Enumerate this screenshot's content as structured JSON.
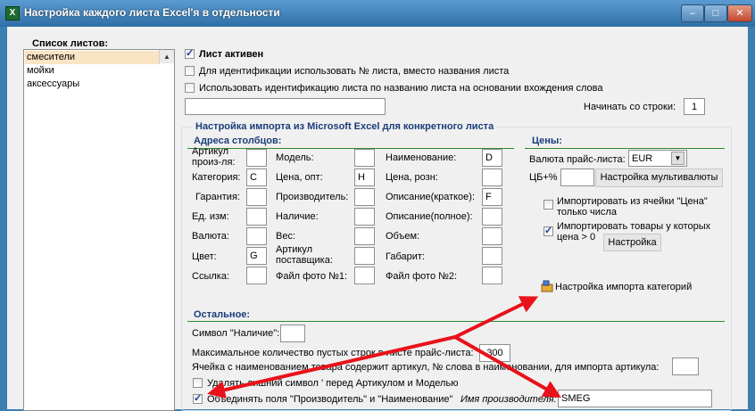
{
  "window": {
    "title": "Настройка каждого листа Excel'я в отдельности",
    "app_icon_text": "X",
    "minimize_glyph": "–",
    "maximize_glyph": "□",
    "close_glyph": "✕"
  },
  "sheets": {
    "header": "Список листов:",
    "items": [
      "смесители",
      "мойки",
      "аксессуары"
    ],
    "selected_index": 0
  },
  "general": {
    "sheet_active_label": "Лист активен",
    "sheet_active_checked": true,
    "use_number_label": "Для идентификации использовать № листа, вместо названия листа",
    "use_number_checked": false,
    "use_word_label": "Использовать идентификацию листа по названию листа на основании вхождения слова",
    "use_word_checked": false,
    "word_value": "",
    "start_row_label": "Начинать со строки:",
    "start_row_value": "1"
  },
  "import_group": {
    "title": "Настройка импорта из Microsoft Excel для конкретного листа"
  },
  "columns": {
    "title": "Адреса столбцов:",
    "fields": [
      {
        "label": "Артикул произ-ля:",
        "value": ""
      },
      {
        "label": "Категория:",
        "value": "C"
      },
      {
        "label": "Гарантия:",
        "value": ""
      },
      {
        "label": "Ед. изм:",
        "value": ""
      },
      {
        "label": "Валюта:",
        "value": ""
      },
      {
        "label": "Цвет:",
        "value": "G"
      },
      {
        "label": "Ссылка:",
        "value": ""
      },
      {
        "label": "Модель:",
        "value": ""
      },
      {
        "label": "Цена, опт:",
        "value": "H"
      },
      {
        "label": "Производитель:",
        "value": ""
      },
      {
        "label": "Наличие:",
        "value": ""
      },
      {
        "label": "Вес:",
        "value": ""
      },
      {
        "label": "Артикул поставщика:",
        "value": ""
      },
      {
        "label": "Файл фото №1:",
        "value": ""
      },
      {
        "label": "Наименование:",
        "value": "D"
      },
      {
        "label": "Цена, розн:",
        "value": ""
      },
      {
        "label": "Описание(краткое):",
        "value": "F"
      },
      {
        "label": "Описание(полное):",
        "value": ""
      },
      {
        "label": "Объем:",
        "value": ""
      },
      {
        "label": "Габарит:",
        "value": ""
      },
      {
        "label": "Файл фото №2:",
        "value": ""
      }
    ]
  },
  "prices": {
    "title": "Цены:",
    "currency_label": "Валюта прайс-листа:",
    "currency_value": "EUR",
    "cb_percent_label": "ЦБ+%",
    "cb_percent_value": "",
    "multicurrency_button": "Настройка мультивалюты",
    "import_price_only_label": "Импортировать из ячейки \"Цена\" только числа",
    "import_price_only_checked": false,
    "import_price_gt0_label": "Импортировать товары у которых цена > 0",
    "import_price_gt0_checked": true,
    "settings_button": "Настройка",
    "category_import_label": "Настройка импорта категорий"
  },
  "other": {
    "title": "Остальное:",
    "availability_symbol_label": "Символ \"Наличие\":",
    "availability_symbol_value": "",
    "max_empty_rows_label": "Максимальное количество пустых строк в листе прайс-листа:",
    "max_empty_rows_value": "300",
    "name_contains_article_label": "Ячейка с наименованием товара содержит артикул, № слова в наименовании, для импорта артикула:",
    "name_contains_article_value": "",
    "remove_symbol_label": "Удалять лишний символ ' перед Артикулом и Моделью",
    "remove_symbol_checked": false,
    "merge_fields_label": "Объединять поля \"Производитель\" и \"Наименование\"",
    "merge_fields_checked": true,
    "manufacturer_name_label": "Имя производителя:",
    "manufacturer_name_value": "SMEG"
  },
  "colors": {
    "titlebar": "#3c7fb1",
    "section_heading": "#1a3d7a",
    "divider": "#2e8a2e",
    "arrow": "#e8121a",
    "selected_item": "#f9e4c4"
  }
}
